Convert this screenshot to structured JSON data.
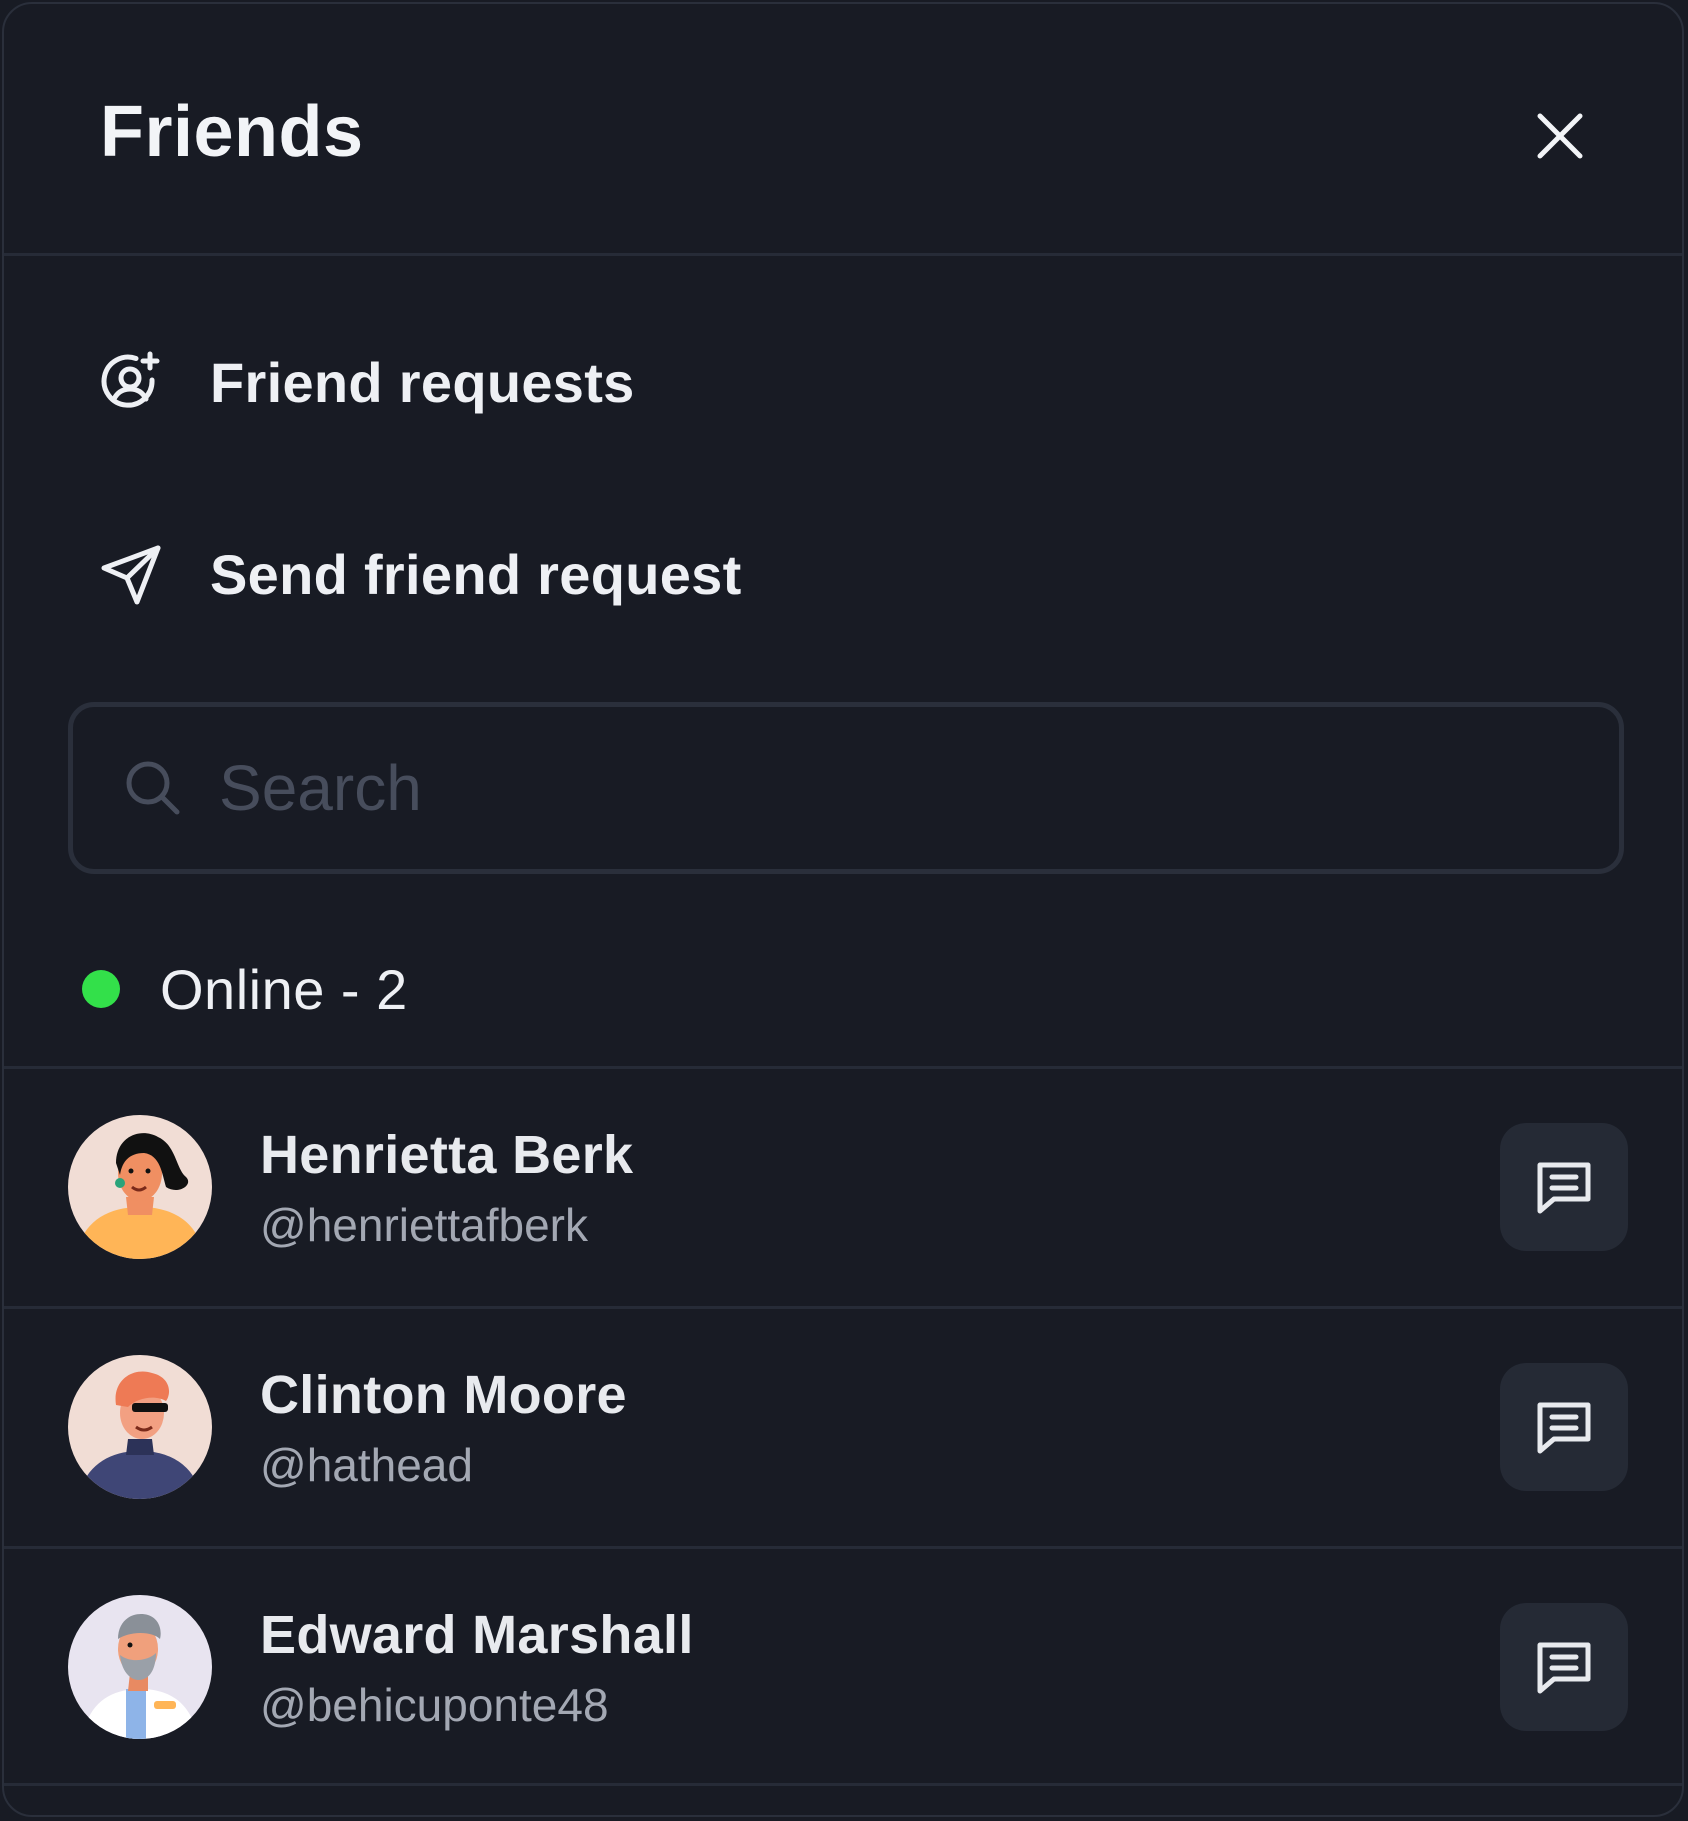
{
  "header": {
    "title": "Friends",
    "close_icon": "close-icon"
  },
  "menu": {
    "items": [
      {
        "label": "Friend requests",
        "icon": "user-plus-icon"
      },
      {
        "label": "Send friend request",
        "icon": "send-icon"
      }
    ]
  },
  "search": {
    "placeholder": "Search",
    "value": "",
    "icon": "search-icon"
  },
  "online": {
    "label": "Online - 2",
    "status_color": "#33e04a"
  },
  "friends": [
    {
      "name": "Henrietta Berk",
      "handle": "@henriettafberk",
      "action_icon": "message-icon"
    },
    {
      "name": "Clinton Moore",
      "handle": "@hathead",
      "action_icon": "message-icon"
    },
    {
      "name": "Edward Marshall",
      "handle": "@behicuponte48",
      "action_icon": "message-icon"
    }
  ],
  "colors": {
    "background": "#181b24",
    "divider": "#262b37",
    "button_bg": "#252a35",
    "text_primary": "#eef0f4",
    "text_secondary": "#a3a8b3",
    "placeholder": "#474d5c"
  }
}
